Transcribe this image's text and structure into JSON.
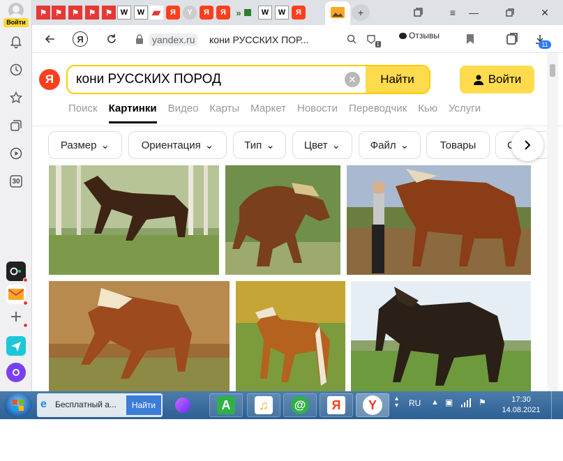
{
  "sidebar": {
    "login_badge": "Войти",
    "counter_label": "30"
  },
  "tabs": {
    "favicons": [
      "pdf",
      "pdf",
      "pdf",
      "pdf",
      "pdf",
      "wikipedia",
      "wikipedia",
      "bookmark",
      "yandex",
      "yandex-browser",
      "yandex",
      "yandex",
      "media",
      "wikipedia",
      "wikipedia",
      "yandex",
      "images"
    ],
    "new_tab_symbol": "+"
  },
  "address_bar": {
    "domain": "yandex.ru",
    "query_title": "кони РУССКИХ ПОР...",
    "reviews_label": "Отзывы",
    "tab_count": "1",
    "downloads_badge": "11"
  },
  "search": {
    "logo_letter": "Я",
    "query": "кони РУССКИХ ПОРОД",
    "find_label": "Найти",
    "login_label": "Войти"
  },
  "services": [
    {
      "label": "Поиск",
      "active": false
    },
    {
      "label": "Картинки",
      "active": true
    },
    {
      "label": "Видео",
      "active": false
    },
    {
      "label": "Карты",
      "active": false
    },
    {
      "label": "Маркет",
      "active": false
    },
    {
      "label": "Новости",
      "active": false
    },
    {
      "label": "Переводчик",
      "active": false
    },
    {
      "label": "Кью",
      "active": false
    },
    {
      "label": "Услуги",
      "active": false
    }
  ],
  "filters": [
    {
      "label": "Размер",
      "dropdown": true
    },
    {
      "label": "Ориентация",
      "dropdown": true
    },
    {
      "label": "Тип",
      "dropdown": true
    },
    {
      "label": "Цвет",
      "dropdown": true
    },
    {
      "label": "Файл",
      "dropdown": true
    },
    {
      "label": "Товары",
      "dropdown": false
    },
    {
      "label": "С",
      "dropdown": false
    }
  ],
  "taskbar": {
    "window_title": "Бесплатный а...",
    "window_find": "Найти",
    "lang": "RU",
    "time": "17:30",
    "date": "14.08.2021"
  },
  "colors": {
    "accent_yellow": "#ffdb4d",
    "yandex_red": "#fc3f1d",
    "taskbar_blue": "#2c5f93"
  }
}
